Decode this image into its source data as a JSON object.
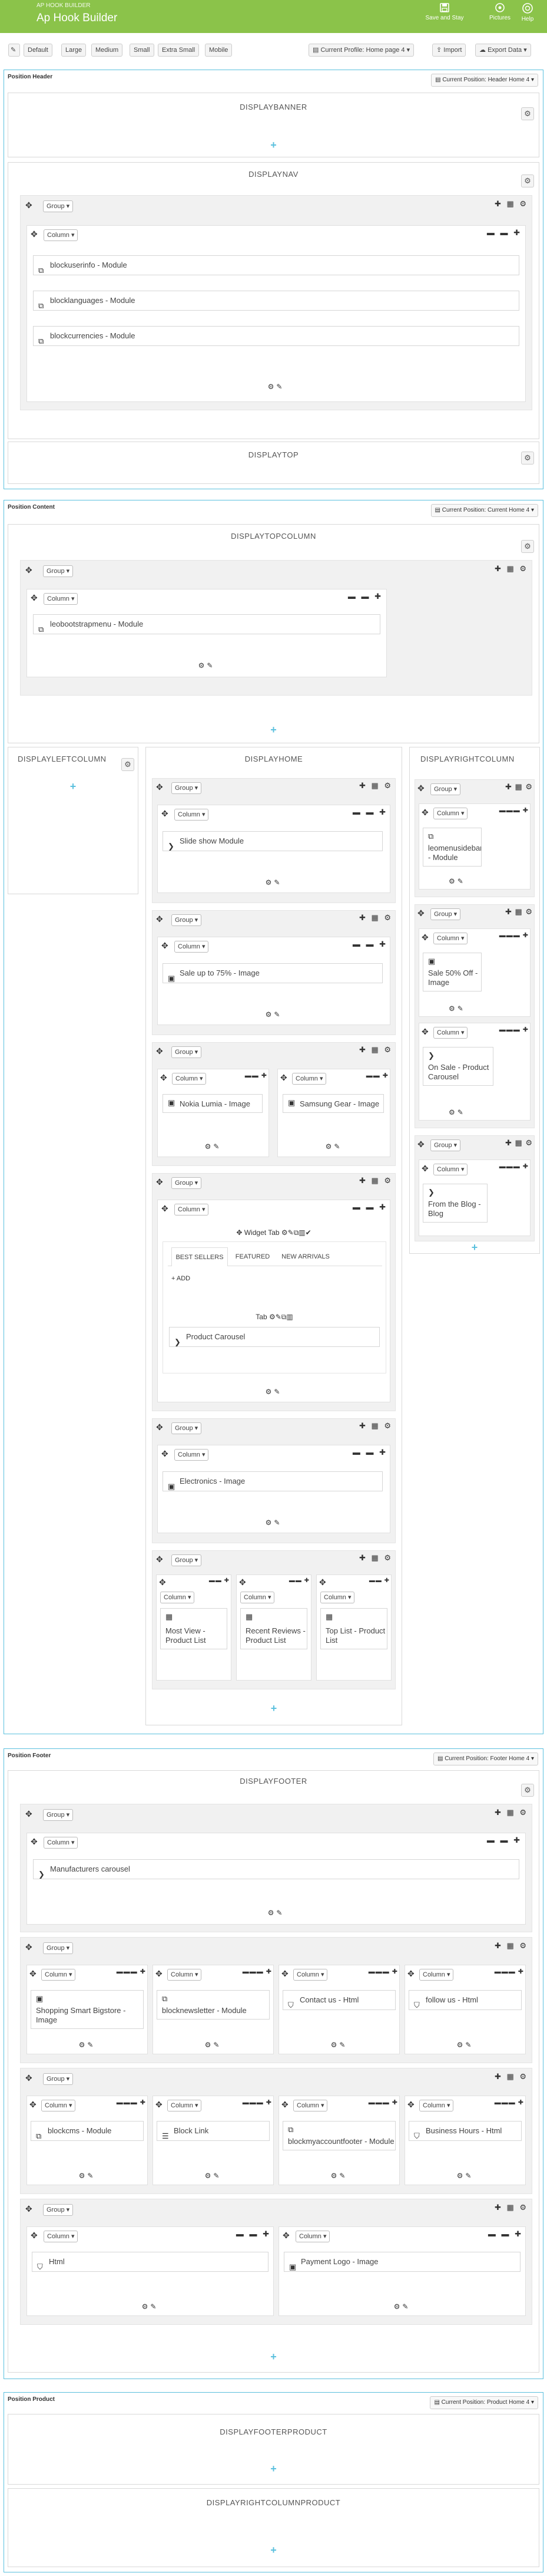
{
  "header": {
    "breadcrumb": "AP HOOK BUILDER",
    "title": "Ap Hook Builder",
    "buttons": {
      "save": "Save and Stay",
      "pictures": "Pictures",
      "help": "Help"
    },
    "brand_color": "#8bc34a"
  },
  "toolbar": {
    "sizes": [
      "Default",
      "Large",
      "Medium",
      "Small",
      "Extra Small",
      "Mobile"
    ],
    "current_profile": "Current Profile: Home page 4",
    "import": "Import",
    "export": "Export Data"
  },
  "labels": {
    "group": "Group",
    "column": "Column"
  },
  "positions": {
    "header": {
      "label": "Position Header",
      "select": "Current Position: Header Home 4",
      "hooks": {
        "banner": "DISPLAYBANNER",
        "nav": "DISPLAYNAV",
        "top": "DISPLAYTOP"
      },
      "nav_modules": [
        "blockuserinfo - Module",
        "blocklanguages - Module",
        "blockcurrencies - Module"
      ]
    },
    "content": {
      "label": "Position Content",
      "select": "Current Position: Current Home 4",
      "hooks": {
        "topcolumn": "DISPLAYTOPCOLUMN",
        "left": "DISPLAYLEFTCOLUMN",
        "home": "DISPLAYHOME",
        "right": "DISPLAYRIGHTCOLUMN"
      },
      "topcolumn_module": "leobootstrapmenu - Module",
      "home": {
        "slideshow": "Slide show Module",
        "sale_image": "Sale up to 75% - Image",
        "nokia": "Nokia Lumia - Image",
        "samsung": "Samsung Gear - Image",
        "widget_tab": "Widget Tab",
        "tabs": [
          "BEST SELLERS",
          "FEATURED",
          "NEW ARRIVALS"
        ],
        "add": "ADD",
        "tab_label": "Tab",
        "product_carousel": "Product Carousel",
        "electronics": "Electronics - Image",
        "most_view": "Most View - Product List",
        "recent_reviews": "Recent Reviews - Product List",
        "top_list": "Top List - Product List"
      },
      "right": {
        "leomenusidebar": "leomenusidebar - Module",
        "sale50": "Sale 50% Off - Image",
        "on_sale": "On Sale - Product Carousel",
        "from_blog": "From the Blog - Blog"
      }
    },
    "footer": {
      "label": "Position Footer",
      "select": "Current Position: Footer Home 4",
      "hook": "DISPLAYFOOTER",
      "manufacturers": "Manufacturers carousel",
      "row2": [
        "Shopping Smart Bigstore - Image",
        "blocknewsletter - Module",
        "Contact us - Html",
        "follow us - Html"
      ],
      "row3": [
        "blockcms - Module",
        "Block Link",
        "blockmyaccountfooter - Module",
        "Business Hours - Html"
      ],
      "row4": [
        "Html",
        "Payment Logo - Image"
      ]
    },
    "product": {
      "label": "Position Product",
      "select": "Current Position: Product Home 4",
      "hooks": {
        "footerproduct": "DISPLAYFOOTERPRODUCT",
        "rightproduct": "DISPLAYRIGHTCOLUMNPRODUCT"
      }
    }
  }
}
